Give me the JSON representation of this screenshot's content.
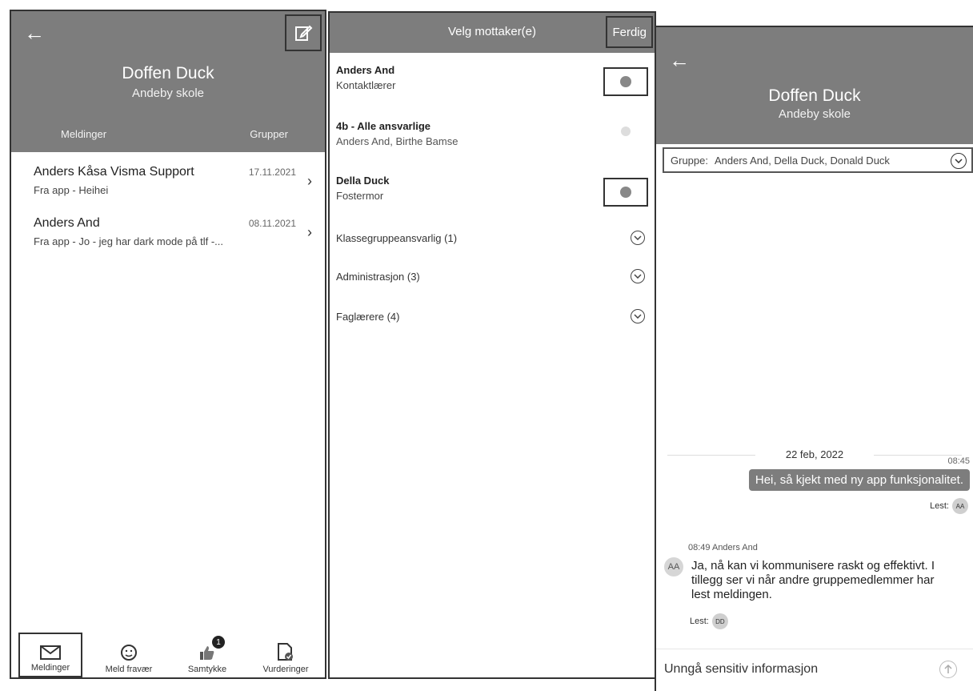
{
  "panel1": {
    "profile_name": "Doffen Duck",
    "school": "Andeby skole",
    "tabs": [
      "Meldinger",
      "Grupper"
    ],
    "messages": [
      {
        "sender": "Anders Kåsa Visma Support",
        "preview": "Fra app - Heihei",
        "date": "17.11.2021"
      },
      {
        "sender": "Anders And",
        "preview": "Fra app - Jo - jeg har dark mode på tlf -...",
        "date": "08.11.2021"
      }
    ],
    "nav": [
      {
        "label": "Meldinger",
        "icon": "envelope-icon",
        "active": true
      },
      {
        "label": "Meld fravær",
        "icon": "smiley-icon",
        "active": false
      },
      {
        "label": "Samtykke",
        "icon": "thumbs-up-icon",
        "active": false,
        "badge": "1"
      },
      {
        "label": "Vurderinger",
        "icon": "document-check-icon",
        "active": false
      }
    ]
  },
  "panel2": {
    "title": "Velg mottaker(e)",
    "done_label": "Ferdig",
    "recipients": [
      {
        "name": "Anders And",
        "role": "Kontaktlærer"
      },
      {
        "name": "4b - Alle ansvarlige",
        "role": "Anders And, Birthe Bamse"
      },
      {
        "name": "Della Duck",
        "role": "Fostermor"
      }
    ],
    "groups": [
      "Klassegruppeansvarlig (1)",
      "Administrasjon (3)",
      "Faglærere (4)"
    ]
  },
  "panel3": {
    "profile_name": "Doffen Duck",
    "school": "Andeby skole",
    "group_label": "Gruppe:",
    "group_members": "Anders And, Della Duck, Donald Duck",
    "date": "22 feb, 2022",
    "outgoing": {
      "time": "08:45",
      "text": "Hei, så kjekt med ny app funksjonalitet.",
      "read_label": "Lest:",
      "read_by": "AA"
    },
    "incoming": {
      "meta": "08:49 Anders And",
      "avatar": "AA",
      "text": "Ja, nå kan vi kommunisere raskt og effektivt. I tillegg ser vi når andre gruppemedlemmer har lest meldingen.",
      "read_label": "Lest:",
      "read_by": "DD"
    },
    "compose_placeholder": "Unngå sensitiv informasjon"
  },
  "colors": {
    "header": "#7d7d7d",
    "border": "#333333"
  }
}
